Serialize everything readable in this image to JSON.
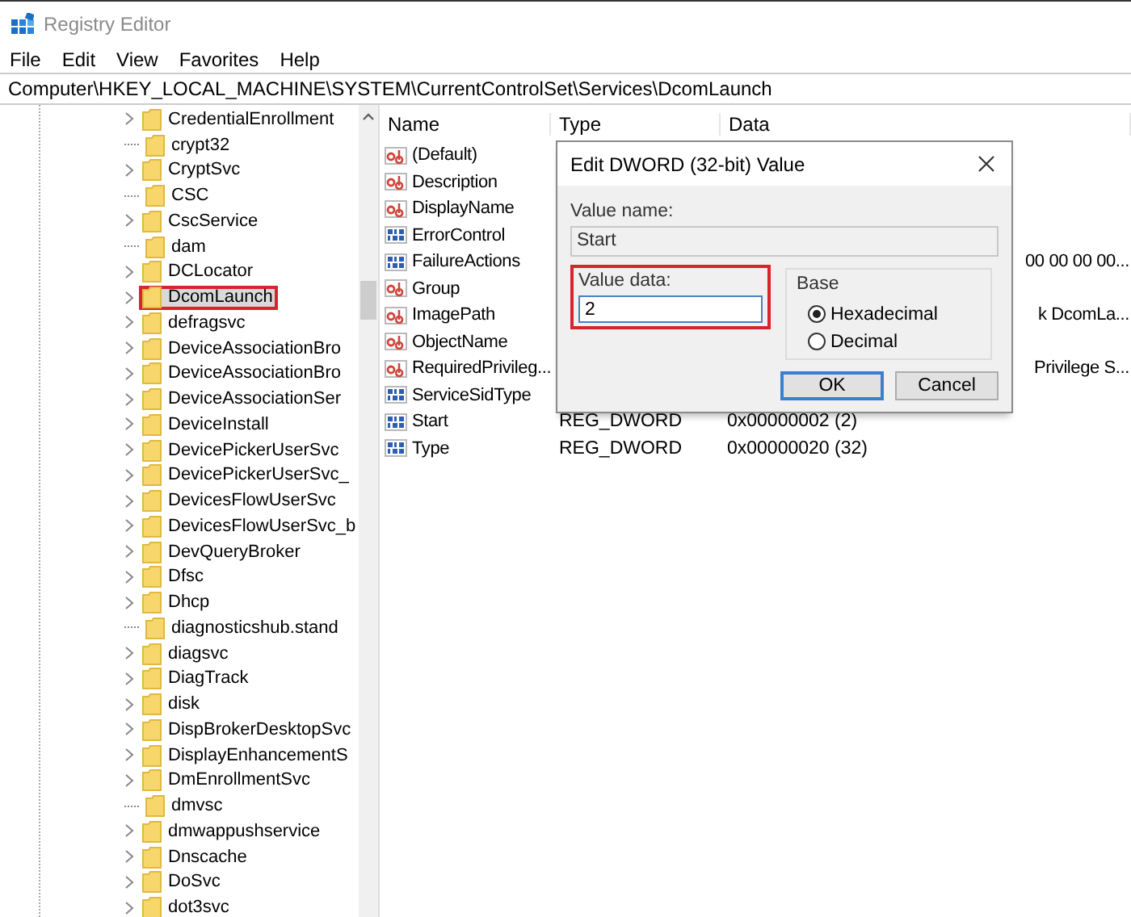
{
  "window": {
    "title": "Registry Editor"
  },
  "menu": [
    "File",
    "Edit",
    "View",
    "Favorites",
    "Help"
  ],
  "address": "Computer\\HKEY_LOCAL_MACHINE\\SYSTEM\\CurrentControlSet\\Services\\DcomLaunch",
  "tree": {
    "items": [
      {
        "label": "CredentialEnrollment",
        "expandable": true,
        "selected": false,
        "highlighted": false
      },
      {
        "label": "crypt32",
        "expandable": false,
        "selected": false,
        "highlighted": false
      },
      {
        "label": "CryptSvc",
        "expandable": true,
        "selected": false,
        "highlighted": false
      },
      {
        "label": "CSC",
        "expandable": false,
        "selected": false,
        "highlighted": false
      },
      {
        "label": "CscService",
        "expandable": true,
        "selected": false,
        "highlighted": false
      },
      {
        "label": "dam",
        "expandable": false,
        "selected": false,
        "highlighted": false
      },
      {
        "label": "DCLocator",
        "expandable": true,
        "selected": false,
        "highlighted": false
      },
      {
        "label": "DcomLaunch",
        "expandable": true,
        "selected": true,
        "highlighted": true
      },
      {
        "label": "defragsvc",
        "expandable": true,
        "selected": false,
        "highlighted": false
      },
      {
        "label": "DeviceAssociationBro",
        "expandable": true,
        "selected": false,
        "highlighted": false
      },
      {
        "label": "DeviceAssociationBro",
        "expandable": true,
        "selected": false,
        "highlighted": false
      },
      {
        "label": "DeviceAssociationSer",
        "expandable": true,
        "selected": false,
        "highlighted": false
      },
      {
        "label": "DeviceInstall",
        "expandable": true,
        "selected": false,
        "highlighted": false
      },
      {
        "label": "DevicePickerUserSvc",
        "expandable": true,
        "selected": false,
        "highlighted": false
      },
      {
        "label": "DevicePickerUserSvc_",
        "expandable": true,
        "selected": false,
        "highlighted": false
      },
      {
        "label": "DevicesFlowUserSvc",
        "expandable": true,
        "selected": false,
        "highlighted": false
      },
      {
        "label": "DevicesFlowUserSvc_b",
        "expandable": true,
        "selected": false,
        "highlighted": false
      },
      {
        "label": "DevQueryBroker",
        "expandable": true,
        "selected": false,
        "highlighted": false
      },
      {
        "label": "Dfsc",
        "expandable": true,
        "selected": false,
        "highlighted": false
      },
      {
        "label": "Dhcp",
        "expandable": true,
        "selected": false,
        "highlighted": false
      },
      {
        "label": "diagnosticshub.stand",
        "expandable": false,
        "selected": false,
        "highlighted": false
      },
      {
        "label": "diagsvc",
        "expandable": true,
        "selected": false,
        "highlighted": false
      },
      {
        "label": "DiagTrack",
        "expandable": true,
        "selected": false,
        "highlighted": false
      },
      {
        "label": "disk",
        "expandable": true,
        "selected": false,
        "highlighted": false
      },
      {
        "label": "DispBrokerDesktopSvc",
        "expandable": true,
        "selected": false,
        "highlighted": false
      },
      {
        "label": "DisplayEnhancementS",
        "expandable": true,
        "selected": false,
        "highlighted": false
      },
      {
        "label": "DmEnrollmentSvc",
        "expandable": true,
        "selected": false,
        "highlighted": false
      },
      {
        "label": "dmvsc",
        "expandable": false,
        "selected": false,
        "highlighted": false
      },
      {
        "label": "dmwappushservice",
        "expandable": true,
        "selected": false,
        "highlighted": false
      },
      {
        "label": "Dnscache",
        "expandable": true,
        "selected": false,
        "highlighted": false
      },
      {
        "label": "DoSvc",
        "expandable": true,
        "selected": false,
        "highlighted": false
      },
      {
        "label": "dot3svc",
        "expandable": true,
        "selected": false,
        "highlighted": false
      }
    ]
  },
  "values": {
    "columns": [
      "Name",
      "Type",
      "Data"
    ],
    "rows": [
      {
        "kind": "string",
        "name": "(Default)"
      },
      {
        "kind": "string",
        "name": "Description"
      },
      {
        "kind": "string",
        "name": "DisplayName"
      },
      {
        "kind": "binary",
        "name": "ErrorControl"
      },
      {
        "kind": "binary",
        "name": "FailureActions",
        "data": "00 00 00 00...",
        "clipped": true
      },
      {
        "kind": "string",
        "name": "Group"
      },
      {
        "kind": "string",
        "name": "ImagePath",
        "data": "k DcomLa...",
        "clipped": true
      },
      {
        "kind": "string",
        "name": "ObjectName"
      },
      {
        "kind": "string",
        "name": "RequiredPrivileg...",
        "data": "Privilege S...",
        "clipped": true
      },
      {
        "kind": "binary",
        "name": "ServiceSidType"
      },
      {
        "kind": "binary",
        "name": "Start",
        "type": "REG_DWORD",
        "data": "0x00000002 (2)",
        "clipped": false
      },
      {
        "kind": "binary",
        "name": "Type",
        "type": "REG_DWORD",
        "data": "0x00000020 (32)",
        "clipped": false
      }
    ]
  },
  "dialog": {
    "title": "Edit DWORD (32-bit) Value",
    "value_name_label": "Value name:",
    "value_name": "Start",
    "value_data_label": "Value data:",
    "value_data": "2",
    "value_data_highlighted": true,
    "base_label": "Base",
    "bases": [
      {
        "label": "Hexadecimal",
        "selected": true
      },
      {
        "label": "Decimal",
        "selected": false
      }
    ],
    "buttons": [
      {
        "label": "OK",
        "default": true
      },
      {
        "label": "Cancel",
        "default": false
      }
    ]
  }
}
